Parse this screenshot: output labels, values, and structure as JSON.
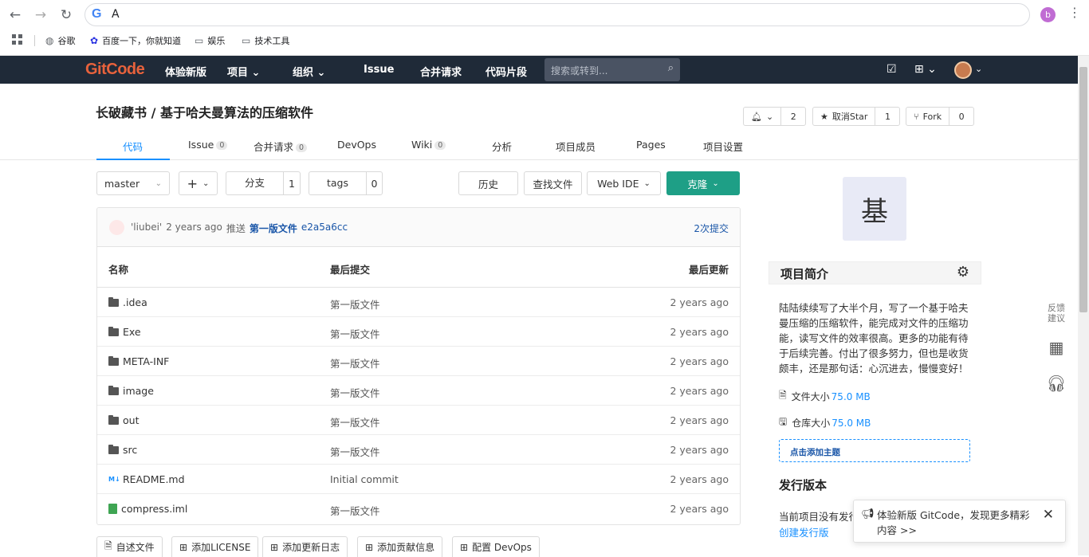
{
  "browser": {
    "address_text": "A",
    "profile_initial": "b",
    "bookmarks": [
      {
        "label": "谷歌",
        "icon": "globe-icon"
      },
      {
        "label": "百度一下，你就知道",
        "icon": "baidu-paw-icon"
      },
      {
        "label": "娱乐",
        "icon": "folder-icon"
      },
      {
        "label": "技术工具",
        "icon": "folder-icon"
      }
    ]
  },
  "topnav": {
    "logo": "GitCode",
    "items": [
      "体验新版",
      "项目",
      "组织",
      "Issue",
      "合并请求",
      "代码片段"
    ],
    "search_placeholder": "搜索或转到..."
  },
  "project": {
    "title": "长破藏书 / 基于哈夫曼算法的压缩软件",
    "notify_count": "2",
    "star_label": "取消Star",
    "star_count": "1",
    "fork_label": "Fork",
    "fork_count": "0"
  },
  "tabs": [
    {
      "label": "代码",
      "badge": ""
    },
    {
      "label": "Issue",
      "badge": "0"
    },
    {
      "label": "合并请求",
      "badge": "0"
    },
    {
      "label": "DevOps",
      "badge": ""
    },
    {
      "label": "Wiki",
      "badge": "0"
    },
    {
      "label": "分析",
      "badge": ""
    },
    {
      "label": "项目成员",
      "badge": ""
    },
    {
      "label": "Pages",
      "badge": ""
    },
    {
      "label": "项目设置",
      "badge": ""
    }
  ],
  "controls": {
    "branch": "master",
    "add": "+",
    "branches_label": "分支",
    "branches_count": "1",
    "tags_label": "tags",
    "tags_count": "0",
    "history": "历史",
    "find_file": "查找文件",
    "web_ide": "Web IDE",
    "clone": "克隆"
  },
  "last_commit": {
    "author": "'liubei'",
    "time": "2 years ago",
    "action": "推送",
    "message": "第一版文件",
    "sha": "e2a5a6cc",
    "commit_count": "2次提交"
  },
  "table": {
    "headers": [
      "名称",
      "最后提交",
      "最后更新"
    ],
    "rows": [
      {
        "name": ".idea",
        "type": "folder",
        "commit": "第一版文件",
        "updated": "2 years ago"
      },
      {
        "name": "Exe",
        "type": "folder",
        "commit": "第一版文件",
        "updated": "2 years ago"
      },
      {
        "name": "META-INF",
        "type": "folder",
        "commit": "第一版文件",
        "updated": "2 years ago"
      },
      {
        "name": "image",
        "type": "folder",
        "commit": "第一版文件",
        "updated": "2 years ago"
      },
      {
        "name": "out",
        "type": "folder",
        "commit": "第一版文件",
        "updated": "2 years ago"
      },
      {
        "name": "src",
        "type": "folder",
        "commit": "第一版文件",
        "updated": "2 years ago"
      },
      {
        "name": "README.md",
        "type": "markdown",
        "commit": "Initial commit",
        "updated": "2 years ago"
      },
      {
        "name": "compress.iml",
        "type": "iml",
        "commit": "第一版文件",
        "updated": "2 years ago"
      }
    ]
  },
  "bottom_buttons": [
    "自述文件",
    "添加LICENSE",
    "添加更新日志",
    "添加贡献信息",
    "配置 DevOps"
  ],
  "sidebar": {
    "avatar_char": "基",
    "intro_title": "项目简介",
    "intro_text": "陆陆续续写了大半个月，写了一个基于哈夫曼压缩的压缩软件，能完成对文件的压缩功能，读写文件的效率很高。更多的功能有待于后续完善。付出了很多努力，但也是收货颇丰，还是那句话：心沉进去，慢慢变好！",
    "file_size_label": "文件大小",
    "file_size_value": "75.0 MB",
    "repo_size_label": "仓库大小",
    "repo_size_value": "75.0 MB",
    "add_topic": "点击添加主题",
    "release_title": "发行版本",
    "release_text": "当前项目没有发行",
    "release_link": "创建发行版"
  },
  "float_tools": {
    "feedback": "反馈建议"
  },
  "toast": {
    "text": "体验新版 GitCode，发现更多精彩内容 >>",
    "close": "✕"
  }
}
